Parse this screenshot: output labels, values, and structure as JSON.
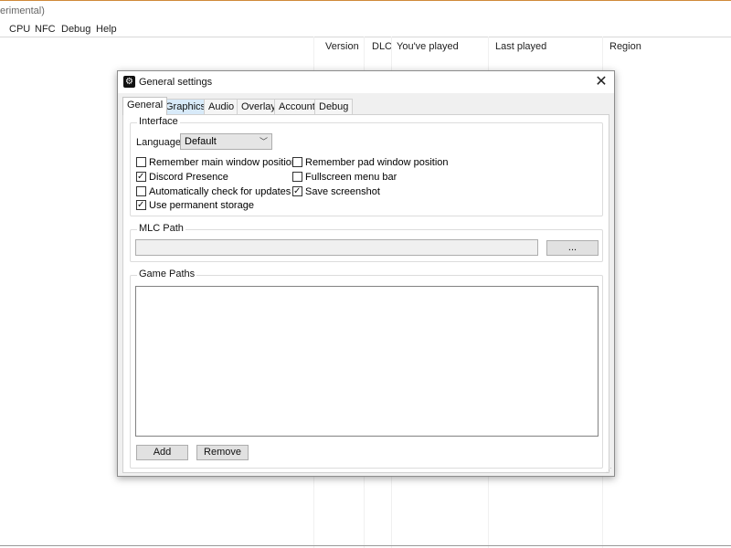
{
  "main_window": {
    "title": "erimental)",
    "menu": [
      "CPU",
      "NFC",
      "Debug",
      "Help"
    ],
    "columns": [
      "Version",
      "DLC",
      "You've played",
      "Last played",
      "Region"
    ]
  },
  "dialog": {
    "title": "General settings",
    "close_glyph": "✕",
    "tabs": [
      "General",
      "Graphics",
      "Audio",
      "Overlay",
      "Account",
      "Debug"
    ],
    "active_tab": "General",
    "interface": {
      "label": "Interface",
      "language_label": "Language",
      "language_value": "Default",
      "checkboxes": [
        {
          "label": "Remember main window position",
          "checked": false
        },
        {
          "label": "Discord Presence",
          "checked": true
        },
        {
          "label": "Automatically check for updates",
          "checked": false
        },
        {
          "label": "Use permanent storage",
          "checked": true
        },
        {
          "label": "Remember pad window position",
          "checked": false
        },
        {
          "label": "Fullscreen menu bar",
          "checked": false
        },
        {
          "label": "Save screenshot",
          "checked": true
        }
      ]
    },
    "mlc_path": {
      "label": "MLC Path",
      "value": "",
      "browse_label": "..."
    },
    "game_paths": {
      "label": "Game Paths",
      "add_label": "Add",
      "remove_label": "Remove"
    }
  }
}
